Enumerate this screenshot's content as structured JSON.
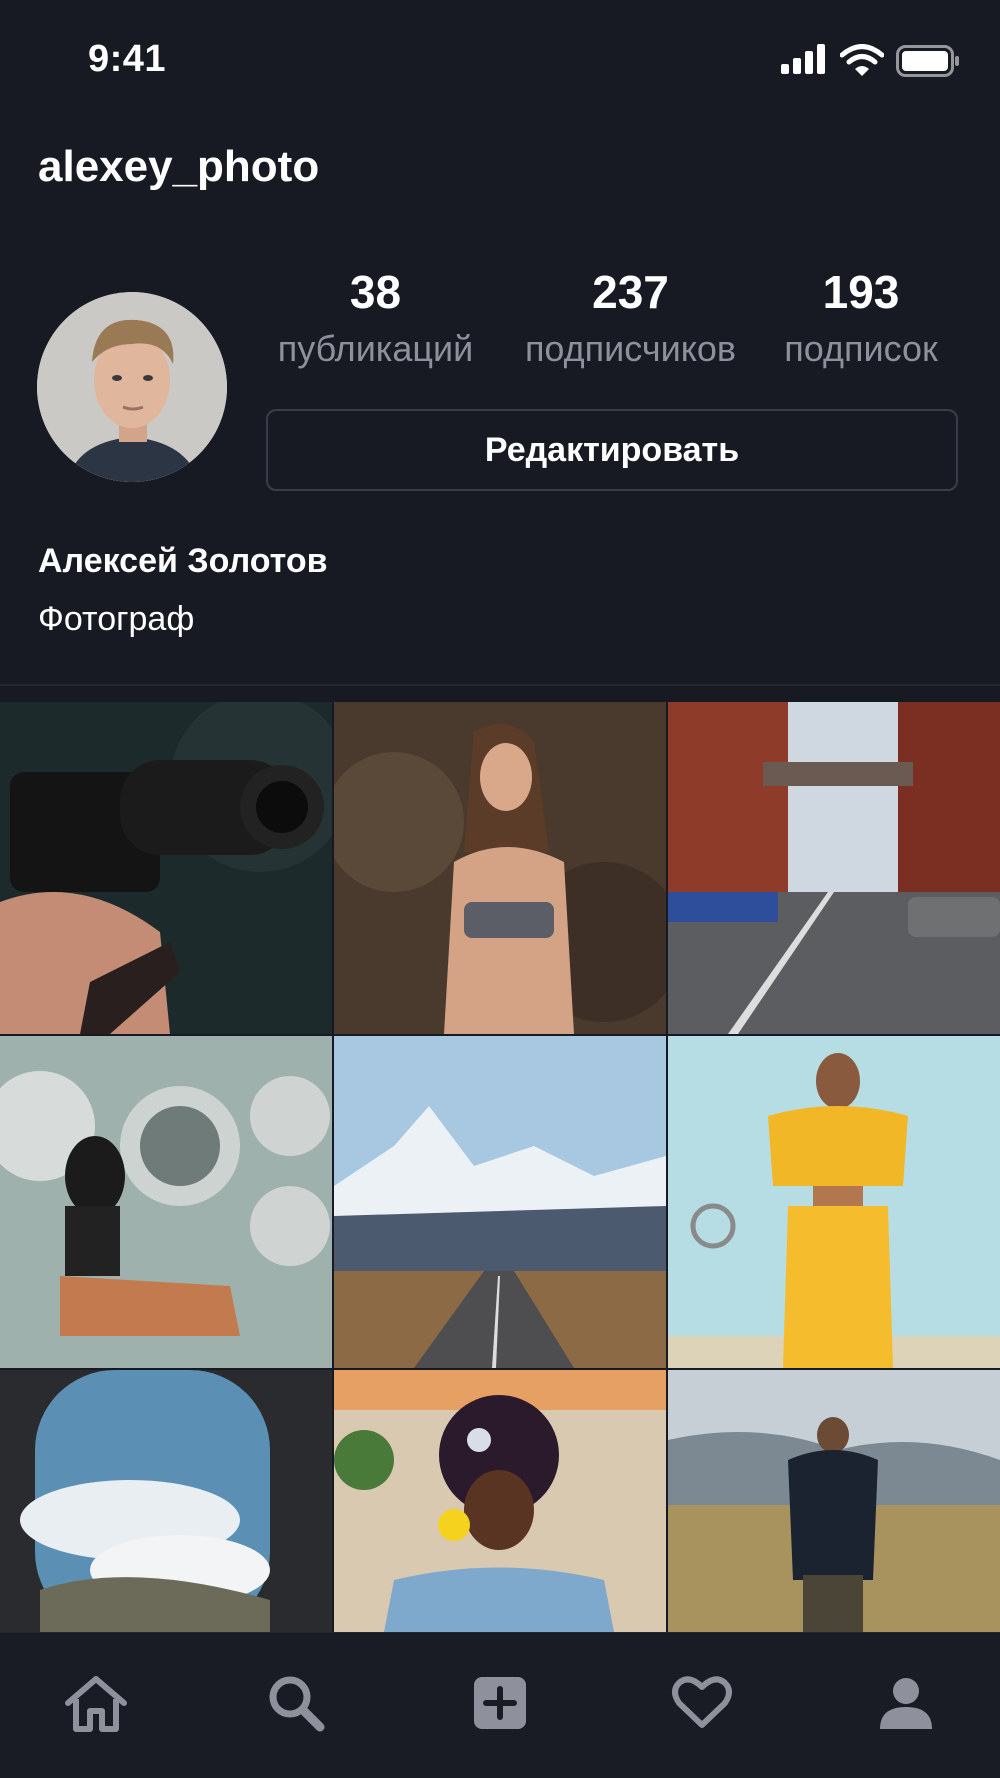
{
  "status_bar": {
    "time": "9:41"
  },
  "profile": {
    "username": "alexey_photo",
    "full_name": "Алексей Золотов",
    "bio": "Фотограф",
    "edit_label": "Редактировать"
  },
  "stats": [
    {
      "value": "38",
      "label": "публикаций"
    },
    {
      "value": "237",
      "label": "подписчиков"
    },
    {
      "value": "193",
      "label": "подписок"
    }
  ],
  "grid": {
    "posts": [
      "camera-photo",
      "portrait-rock-photo",
      "city-street-photo",
      "laundromat-photo",
      "mountain-road-photo",
      "yellow-outfit-photo",
      "airplane-window-photo",
      "flower-portrait-photo",
      "man-field-photo"
    ]
  },
  "bottom_nav": {
    "items": [
      "home-icon",
      "search-icon",
      "add-post-icon",
      "heart-icon",
      "profile-icon"
    ]
  },
  "colors": {
    "background": "#171923",
    "muted_text": "#8e919c",
    "border": "#3a3d48"
  }
}
